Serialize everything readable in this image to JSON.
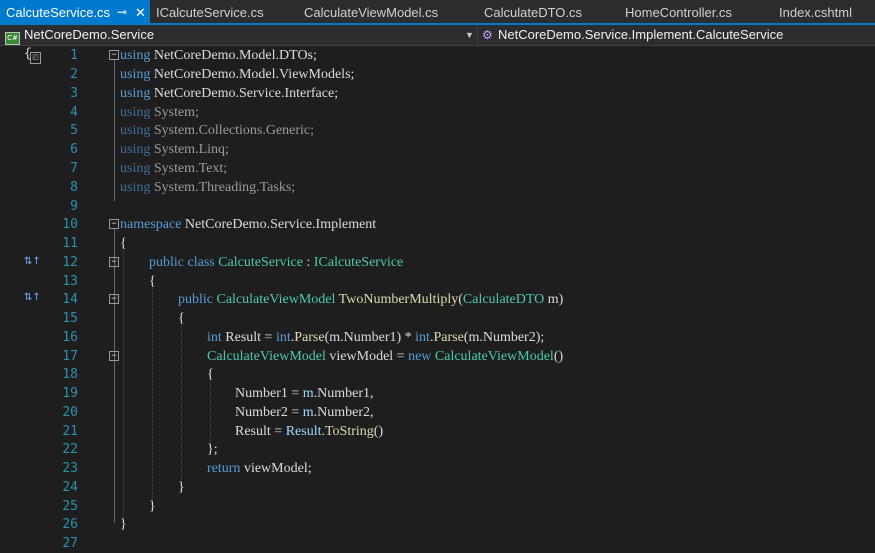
{
  "tabs": [
    {
      "label": "CalcuteService.cs",
      "active": true,
      "pin": "⊸",
      "close": "✕"
    },
    {
      "label": "ICalcuteService.cs"
    },
    {
      "label": "CalculateViewModel.cs"
    },
    {
      "label": "CalculateDTO.cs"
    },
    {
      "label": "HomeController.cs"
    },
    {
      "label": "Index.cshtml"
    }
  ],
  "nav": {
    "project_icon": "C#",
    "project": "NetCoreDemo.Service",
    "dropdown_icon": "chevron-down-icon",
    "member": "NetCoreDemo.Service.Implement.CalcuteService"
  },
  "colors": {
    "accent": "#007acc",
    "keyword": "#569cd6",
    "type": "#4ec9b0",
    "method": "#dcdcaa",
    "variable": "#9cdcfe",
    "line_number": "#2b91af",
    "text": "#dcdcdc"
  },
  "gutter": {
    "brace": "{",
    "lock_icon": "lock-icon"
  },
  "lines": [
    {
      "n": "1"
    },
    {
      "n": "2"
    },
    {
      "n": "3"
    },
    {
      "n": "4"
    },
    {
      "n": "5"
    },
    {
      "n": "6"
    },
    {
      "n": "7"
    },
    {
      "n": "8"
    },
    {
      "n": "9"
    },
    {
      "n": "10"
    },
    {
      "n": "11"
    },
    {
      "n": "12"
    },
    {
      "n": "13"
    },
    {
      "n": "14"
    },
    {
      "n": "15"
    },
    {
      "n": "16"
    },
    {
      "n": "17"
    },
    {
      "n": "18"
    },
    {
      "n": "19"
    },
    {
      "n": "20"
    },
    {
      "n": "21"
    },
    {
      "n": "22"
    },
    {
      "n": "23"
    },
    {
      "n": "24"
    },
    {
      "n": "25"
    },
    {
      "n": "26"
    },
    {
      "n": "27"
    }
  ],
  "code": {
    "l1": [
      "using",
      " NetCoreDemo.Model.DTOs;"
    ],
    "l2": [
      "using",
      " NetCoreDemo.Model.ViewModels;"
    ],
    "l3": [
      "using",
      " NetCoreDemo.Service.Interface;"
    ],
    "l4": [
      "using",
      " System;"
    ],
    "l5": [
      "using",
      " System.Collections.Generic;"
    ],
    "l6": [
      "using",
      " System.Linq;"
    ],
    "l7": [
      "using",
      " System.Text;"
    ],
    "l8": [
      "using",
      " System.Threading.Tasks;"
    ],
    "l10": [
      "namespace",
      " NetCoreDemo.Service.Implement"
    ],
    "l11": "{",
    "l12": [
      "public",
      " class ",
      "CalcuteService",
      " : ",
      "ICalcuteService"
    ],
    "l13": "{",
    "l14": [
      "public",
      " ",
      "CalculateViewModel",
      " ",
      "TwoNumberMultiply",
      "(",
      "CalculateDTO",
      " m)"
    ],
    "l15": "{",
    "l16": [
      "int",
      " Result = ",
      "int",
      ".",
      "Parse",
      "(m.Number1) * ",
      "int",
      ".",
      "Parse",
      "(m.Number2);"
    ],
    "l17": [
      "CalculateViewModel",
      " viewModel = ",
      "new",
      " ",
      "CalculateViewModel",
      "()"
    ],
    "l18": "{",
    "l19": [
      "Number1 = ",
      "m",
      ".Number1,"
    ],
    "l20": [
      "Number2 = ",
      "m",
      ".Number2,"
    ],
    "l21": [
      "Result = ",
      "Result",
      ".",
      "ToString",
      "()"
    ],
    "l22": "};",
    "l23": [
      "return",
      " viewModel;"
    ],
    "l24": "}",
    "l25": "}",
    "l26": "}"
  },
  "markers": {
    "l12": "⇅↑",
    "l14": "⇅↑"
  }
}
